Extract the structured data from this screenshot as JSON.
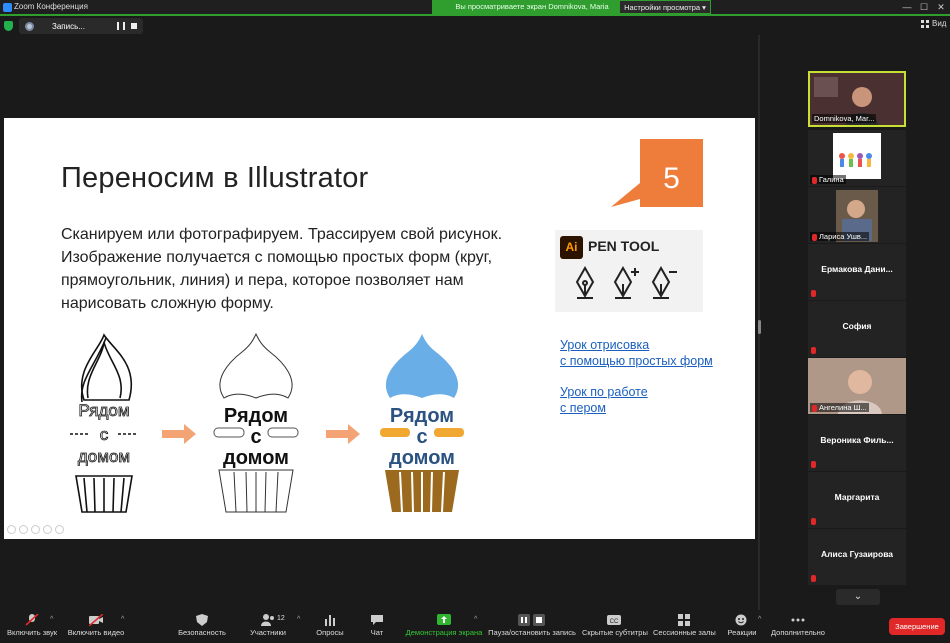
{
  "window": {
    "title": "Zoom Конференция",
    "sharing_banner": "Вы просматриваете экран Domnikova, Maria",
    "view_options": "Настройки просмотра",
    "controls": [
      "—",
      "☐",
      "✕"
    ]
  },
  "recording": {
    "label": "Запись..."
  },
  "view_button": {
    "label": "Вид"
  },
  "slide": {
    "title": "Переносим в Illustrator",
    "badge_number": "5",
    "body": "Сканируем или фотографируем. Трассируем свой рисунок. Изображение получается с помощью простых форм (круг, прямоугольник, линия) и пера, которое позволяет нам нарисовать сложную форму.",
    "pen_tool": {
      "logo": "Ai",
      "label": "PEN TOOL"
    },
    "links": [
      {
        "line1": "Урок отрисовка",
        "line2": "с помощью простых форм"
      },
      {
        "line1": "Урок по работе",
        "line2": "с пером"
      }
    ],
    "cupcake_words": [
      "Рядом",
      "с",
      "домом"
    ]
  },
  "participants": [
    {
      "name": "Domnikova, Mar..."
    },
    {
      "name": "Галина"
    },
    {
      "name": "Лариса Ушв..."
    },
    {
      "name": "Ермакова Дани..."
    },
    {
      "name": "София"
    },
    {
      "name": "Ангелина Ш..."
    },
    {
      "name": "Вероника Филь..."
    },
    {
      "name": "Маргарита"
    },
    {
      "name": "Алиса Гузаирова"
    }
  ],
  "toolbar": {
    "unmute": "Включить звук",
    "start_video": "Включить видео",
    "security": "Безопасность",
    "participants": "Участники",
    "participants_count": "12",
    "polls": "Опросы",
    "chat": "Чат",
    "share_screen": "Демонстрация экрана",
    "pause_recording": "Пауза/остановить запись",
    "captions": "Скрытые субтитры",
    "breakout": "Сессионные залы",
    "reactions": "Реакции",
    "more": "Дополнительно",
    "end": "Завершение"
  },
  "colors": {
    "accent_green": "#2f9e2f",
    "badge_orange": "#ee7d3b",
    "cupcake_blue": "#6aaee8",
    "cupcake_brown": "#9b6a1e",
    "end_red": "#e02828"
  }
}
